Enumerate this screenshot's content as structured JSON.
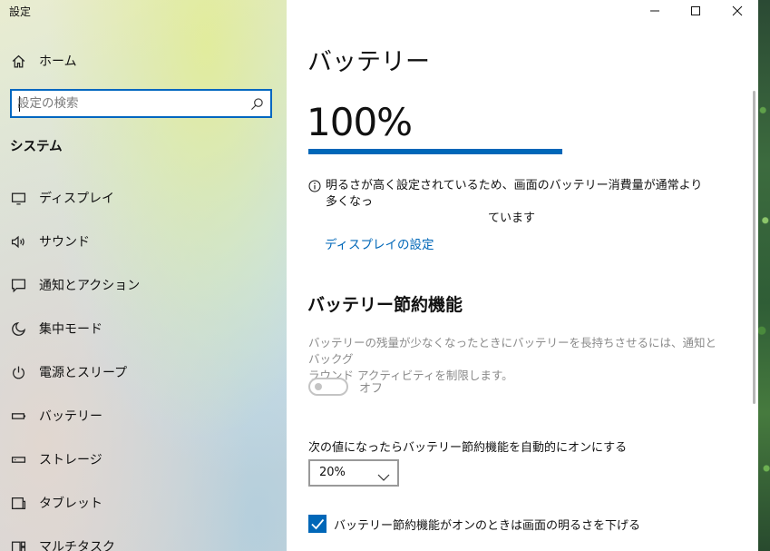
{
  "window": {
    "title": "設定"
  },
  "sidebar": {
    "home_label": "ホーム",
    "search": {
      "placeholder": "設定の検索"
    },
    "section_title": "システム",
    "items": [
      {
        "label": "ディスプレイ",
        "icon": "display-icon"
      },
      {
        "label": "サウンド",
        "icon": "speaker-icon"
      },
      {
        "label": "通知とアクション",
        "icon": "notification-icon"
      },
      {
        "label": "集中モード",
        "icon": "moon-icon"
      },
      {
        "label": "電源とスリープ",
        "icon": "power-icon"
      },
      {
        "label": "バッテリー",
        "icon": "battery-icon"
      },
      {
        "label": "ストレージ",
        "icon": "storage-icon"
      },
      {
        "label": "タブレット",
        "icon": "tablet-icon"
      },
      {
        "label": "マルチタスク",
        "icon": "multitask-icon"
      }
    ]
  },
  "main": {
    "title": "バッテリー",
    "battery_percent": "100%",
    "battery_level": 1.0,
    "info_line1": "明るさが高く設定されているため、画面のバッテリー消費量が通常より多くなっ",
    "info_line2": "ています",
    "display_link": "ディスプレイの設定",
    "saver": {
      "title": "バッテリー節約機能",
      "desc_line1": "バッテリーの残量が少なくなったときにバッテリーを長持ちさせるには、通知とバックグ",
      "desc_line2": "ラウンド アクティビティを制限します。",
      "toggle_label": "オフ",
      "auto_label": "次の値になったらバッテリー節約機能を自動的にオンにする",
      "threshold": "20%",
      "brightness_label": "バッテリー節約機能がオンのときは画面の明るさを下げる",
      "brightness_checked": true
    }
  },
  "colors": {
    "accent": "#0067b8",
    "focus_border": "#0067c0",
    "disabled_text": "#8a8a8a"
  }
}
